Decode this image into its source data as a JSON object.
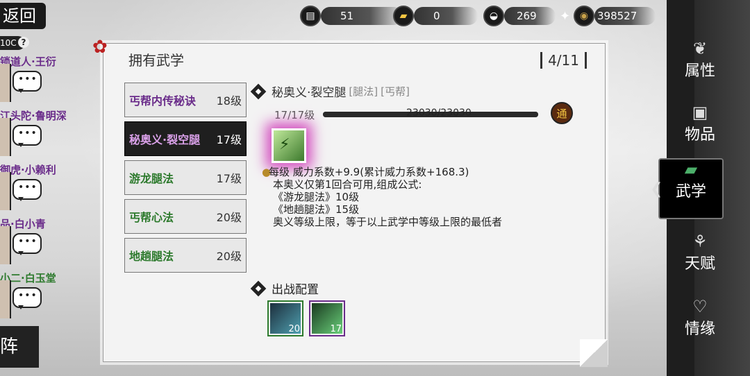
{
  "top_bar": {
    "back_label": "返回",
    "level_chip": "10C",
    "help_icon": "?",
    "currencies": [
      {
        "icon": "bamboo-icon",
        "value": "51",
        "plus": false
      },
      {
        "icon": "gold-bar-icon",
        "value": "0",
        "plus": true
      },
      {
        "icon": "silver-ingot-icon",
        "value": "269",
        "plus": true
      },
      {
        "icon": "coin-icon",
        "value": "398527",
        "plus": false
      }
    ]
  },
  "sidebar": {
    "characters": [
      {
        "name": "锁道人·王衍"
      },
      {
        "name": "江头陀·鲁明深"
      },
      {
        "name": "御虎·小赖利"
      },
      {
        "name": "品·白小青"
      },
      {
        "name": "小二·白玉堂"
      }
    ],
    "formation_label": "阵"
  },
  "right_nav": {
    "items": [
      {
        "label": "属性",
        "icon": "seal-icon"
      },
      {
        "label": "物品",
        "icon": "box-icon"
      },
      {
        "label": "武学",
        "icon": "book-icon",
        "active": true
      },
      {
        "label": "天赋",
        "icon": "branch-icon"
      },
      {
        "label": "情缘",
        "icon": "heart-icon"
      }
    ]
  },
  "panel": {
    "title": "拥有武学",
    "count": "4/11",
    "skills": [
      {
        "name": "丐帮内传秘诀",
        "level": "18级",
        "color": "purple"
      },
      {
        "name": "秘奥义·裂空腿",
        "level": "17级",
        "color": "purple",
        "selected": true
      },
      {
        "name": "游龙腿法",
        "level": "17级",
        "color": "green"
      },
      {
        "name": "丐帮心法",
        "level": "20级",
        "color": "green"
      },
      {
        "name": "地趟腿法",
        "level": "20级",
        "color": "green"
      }
    ],
    "detail": {
      "name": "秘奥义·裂空腿",
      "tag1": "[腿法]",
      "tag2": "[丐帮]",
      "level_text": "17/17级",
      "exp_text": "23030/23030",
      "exp_fraction": 1.0,
      "badge": "通",
      "lines": [
        "每级   威力系数+9.9(累计威力系数+168.3)",
        "本奥义仅第1回合可用,组成公式:",
        "《游龙腿法》10级",
        "《地趟腿法》15级",
        "奥义等级上限，等于以上武学中等级上限的最低者"
      ]
    },
    "battle_title": "出战配置",
    "battle_slots": [
      {
        "level": "20",
        "color": "green"
      },
      {
        "level": "17",
        "color": "purple"
      }
    ]
  }
}
